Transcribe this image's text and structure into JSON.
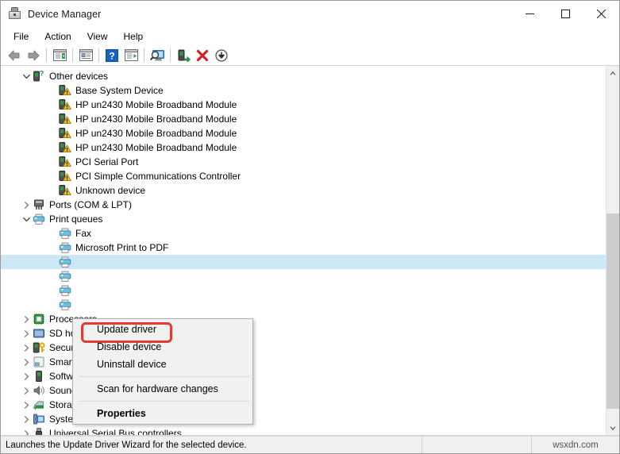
{
  "window": {
    "title": "Device Manager",
    "icon": "device-manager-icon",
    "controls": [
      {
        "name": "minimize-button",
        "glyph": "minimize"
      },
      {
        "name": "maximize-button",
        "glyph": "maximize"
      },
      {
        "name": "close-button",
        "glyph": "close"
      }
    ]
  },
  "menubar": {
    "items": [
      {
        "label": "File"
      },
      {
        "label": "Action"
      },
      {
        "label": "View"
      },
      {
        "label": "Help"
      }
    ]
  },
  "toolbar": {
    "buttons": [
      {
        "name": "back-button",
        "icon": "left-arrow-icon"
      },
      {
        "name": "forward-button",
        "icon": "right-arrow-icon"
      },
      {
        "name": "show-hide-console-tree-button",
        "icon": "console-tree-icon"
      },
      {
        "name": "properties-button",
        "icon": "properties-window-icon"
      },
      {
        "name": "help-button",
        "icon": "question-mark-icon"
      },
      {
        "name": "scan-hardware-button",
        "icon": "scan-list-icon"
      },
      {
        "name": "scan-for-hardware-changes-button",
        "icon": "monitor-magnifier-icon"
      },
      {
        "name": "update-driver-button",
        "icon": "green-arrow-device-icon"
      },
      {
        "name": "uninstall-device-button",
        "icon": "red-x-icon"
      },
      {
        "name": "disable-device-button",
        "icon": "down-arrow-circle-icon"
      }
    ]
  },
  "tree": {
    "nodes": [
      {
        "label": "Other devices",
        "level": 0,
        "twisty": "expanded",
        "icon": "unknown-device-icon"
      },
      {
        "label": "Base System Device",
        "level": 1,
        "twisty": "none",
        "icon": "warning-device-icon"
      },
      {
        "label": "HP un2430 Mobile Broadband Module",
        "level": 1,
        "twisty": "none",
        "icon": "warning-device-icon"
      },
      {
        "label": "HP un2430 Mobile Broadband Module",
        "level": 1,
        "twisty": "none",
        "icon": "warning-device-icon"
      },
      {
        "label": "HP un2430 Mobile Broadband Module",
        "level": 1,
        "twisty": "none",
        "icon": "warning-device-icon"
      },
      {
        "label": "HP un2430 Mobile Broadband Module",
        "level": 1,
        "twisty": "none",
        "icon": "warning-device-icon"
      },
      {
        "label": "PCI Serial Port",
        "level": 1,
        "twisty": "none",
        "icon": "warning-device-icon"
      },
      {
        "label": "PCI Simple Communications Controller",
        "level": 1,
        "twisty": "none",
        "icon": "warning-device-icon"
      },
      {
        "label": "Unknown device",
        "level": 1,
        "twisty": "none",
        "icon": "warning-device-icon"
      },
      {
        "label": "Ports (COM & LPT)",
        "level": 0,
        "twisty": "collapsed",
        "icon": "port-icon"
      },
      {
        "label": "Print queues",
        "level": 0,
        "twisty": "expanded",
        "icon": "printer-icon"
      },
      {
        "label": "Fax",
        "level": 1,
        "twisty": "none",
        "icon": "printer-icon"
      },
      {
        "label": "Microsoft Print to PDF",
        "level": 1,
        "twisty": "none",
        "icon": "printer-icon"
      },
      {
        "label": "",
        "level": 1,
        "twisty": "none",
        "icon": "printer-icon",
        "selected": true
      },
      {
        "label": "",
        "level": 1,
        "twisty": "none",
        "icon": "printer-icon"
      },
      {
        "label": "",
        "level": 1,
        "twisty": "none",
        "icon": "printer-icon"
      },
      {
        "label": "",
        "level": 1,
        "twisty": "none",
        "icon": "printer-icon"
      },
      {
        "label": "Processors",
        "level": 0,
        "twisty": "collapsed",
        "icon": "processor-icon"
      },
      {
        "label": "SD host adapters",
        "level": 0,
        "twisty": "collapsed",
        "icon": "sd-host-icon"
      },
      {
        "label": "Security devices",
        "level": 0,
        "twisty": "collapsed",
        "icon": "security-key-icon"
      },
      {
        "label": "Smart card readers",
        "level": 0,
        "twisty": "collapsed",
        "icon": "smart-card-icon"
      },
      {
        "label": "Software devices",
        "level": 0,
        "twisty": "collapsed",
        "icon": "software-device-icon"
      },
      {
        "label": "Sound, video and game controllers",
        "level": 0,
        "twisty": "collapsed",
        "icon": "speaker-icon"
      },
      {
        "label": "Storage controllers",
        "level": 0,
        "twisty": "collapsed",
        "icon": "storage-controller-icon"
      },
      {
        "label": "System devices",
        "level": 0,
        "twisty": "collapsed",
        "icon": "system-device-icon"
      },
      {
        "label": "Universal Serial Bus controllers",
        "level": 0,
        "twisty": "collapsed",
        "icon": "usb-icon"
      }
    ]
  },
  "context_menu": {
    "items": [
      {
        "label": "Update driver",
        "bold": false,
        "highlighted": true
      },
      {
        "label": "Disable device",
        "bold": false
      },
      {
        "label": "Uninstall device",
        "bold": false
      },
      {
        "separator": true
      },
      {
        "label": "Scan for hardware changes",
        "bold": false
      },
      {
        "separator": true
      },
      {
        "label": "Properties",
        "bold": true
      }
    ],
    "highlight_color": "#e03c31"
  },
  "statusbar": {
    "text": "Launches the Update Driver Wizard for the selected device.",
    "watermark": "wsxdn.com"
  },
  "colors": {
    "selection": "#cce8f7",
    "menu_bg": "#f1f1f1",
    "chrome": "#f0f0f0",
    "highlight_red": "#e03c31"
  }
}
